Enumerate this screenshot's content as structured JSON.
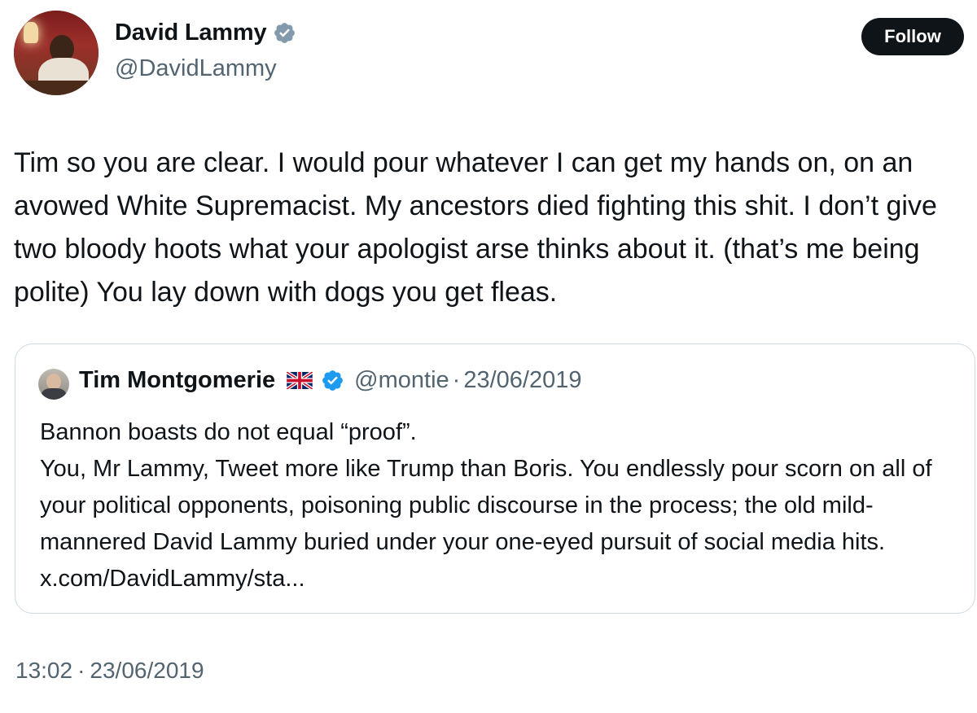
{
  "author": {
    "display_name": "David Lammy",
    "handle": "@DavidLammy",
    "verified_icon": "verified-badge-icon"
  },
  "follow_button": {
    "label": "Follow"
  },
  "tweet": {
    "text": "Tim so you are clear. I would pour whatever I can get my hands on, on an avowed White Supremacist. My ancestors died fighting this shit. I don’t give two bloody hoots what your apologist arse thinks about it. (that’s me being polite) You lay down with dogs you get fleas."
  },
  "quoted_tweet": {
    "display_name": "Tim Montgomerie",
    "flag_icon": "uk-flag-icon",
    "verified_icon": "verified-badge-icon",
    "handle": "@montie",
    "separator": "·",
    "date": "23/06/2019",
    "lines": [
      "Bannon boasts do not equal “proof”.",
      "You, Mr Lammy, Tweet more like Trump than Boris. You endlessly pour scorn on all of your political opponents, poisoning public discourse in the process; the old mild-mannered David Lammy buried under your one-eyed pursuit of social media hits. x.com/DavidLammy/sta..."
    ]
  },
  "timestamp": {
    "time": "13:02",
    "separator": "·",
    "date": "23/06/2019"
  },
  "colors": {
    "text_primary": "#0f1419",
    "text_secondary": "#536471",
    "verified_blue": "#1d9bf0",
    "border": "#cfd9de",
    "button_bg": "#0f1419"
  }
}
